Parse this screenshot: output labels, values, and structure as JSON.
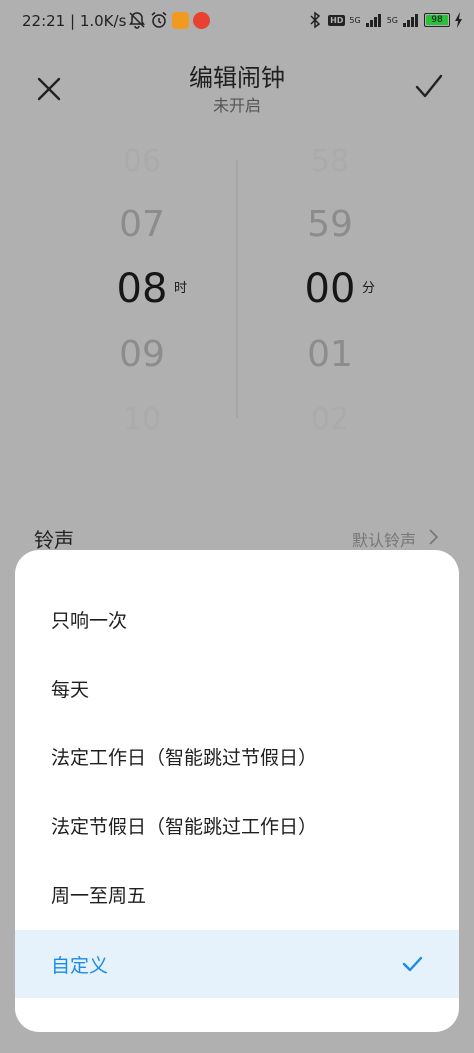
{
  "status_bar": {
    "time": "22:21",
    "speed": "1.0K/s",
    "hd": "HD",
    "net1": "5G",
    "net2": "5G",
    "battery": "98",
    "battery_color": "#2bbf3a"
  },
  "header": {
    "title": "编辑闹钟",
    "subtitle": "未开启"
  },
  "picker": {
    "hours": [
      "06",
      "07",
      "08",
      "09",
      "10"
    ],
    "minutes": [
      "58",
      "59",
      "00",
      "01",
      "02"
    ],
    "hour_unit": "时",
    "minute_unit": "分"
  },
  "ringtone": {
    "label": "铃声",
    "value": "默认铃声"
  },
  "repeat_options": [
    {
      "label": "只响一次"
    },
    {
      "label": "每天"
    },
    {
      "label": "法定工作日（智能跳过节假日）"
    },
    {
      "label": "法定节假日（智能跳过工作日）"
    },
    {
      "label": "周一至周五"
    },
    {
      "label": "自定义"
    }
  ],
  "colors": {
    "accent": "#1a8be8",
    "selected_bg": "#e5f1fb",
    "overlay": "#b0b0b0"
  }
}
